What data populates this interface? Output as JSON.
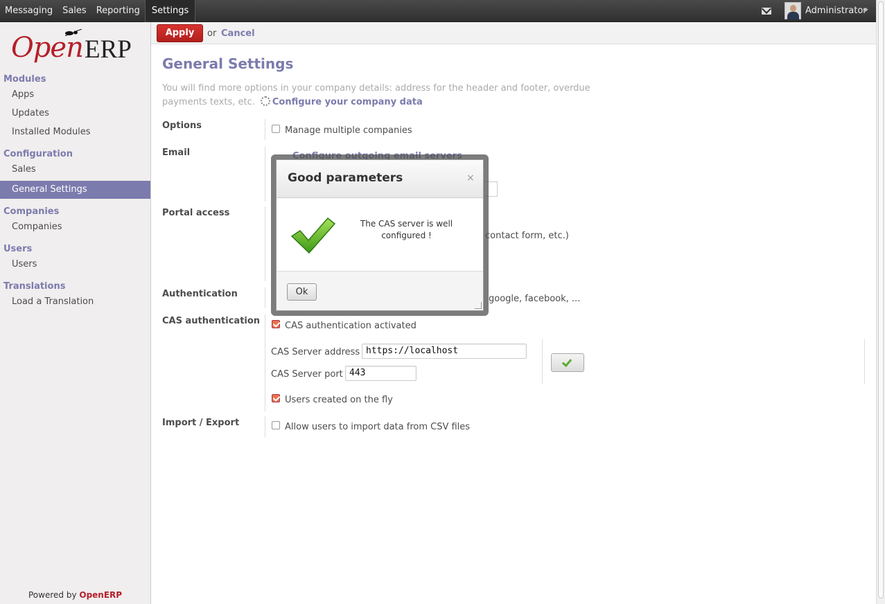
{
  "topbar": {
    "menu": [
      "Messaging",
      "Sales",
      "Reporting",
      "Settings"
    ],
    "user": "Administrator"
  },
  "logo": {
    "part1": "Open",
    "part2": "ERP"
  },
  "sidebar": {
    "modules": "Modules",
    "apps": "Apps",
    "updates": "Updates",
    "installed_modules": "Installed Modules",
    "configuration": "Configuration",
    "sales": "Sales",
    "general_settings": "General Settings",
    "companies_section": "Companies",
    "companies": "Companies",
    "users_section": "Users",
    "users": "Users",
    "translations": "Translations",
    "load_translation": "Load a Translation",
    "powered_prefix": "Powered by ",
    "powered_brand": "OpenERP"
  },
  "actions": {
    "apply": "Apply",
    "or": "or",
    "cancel": "Cancel"
  },
  "main": {
    "title": "General Settings",
    "intro": "You will find more options in your company details: address for the header and footer, overdue payments texts, etc.",
    "configure_link": "Configure your company data",
    "options_label": "Options",
    "manage_companies": "Manage multiple companies",
    "email_label": "Email",
    "email_partial": "Configure outgoing email servers",
    "portal_label": "Portal access",
    "portal_partial": "contact form, etc.)",
    "auth_label": "Authentication",
    "auth_partial": "google, facebook, ...",
    "cas_label": "CAS authentication",
    "cas_activated": "CAS authentication activated",
    "cas_address_label": "CAS Server address",
    "cas_address_value": "https://localhost",
    "cas_port_label": "CAS Server port",
    "cas_port_value": "443",
    "users_on_fly": "Users created on the fly",
    "import_label": "Import / Export",
    "import_csv": "Allow users to import data from CSV files"
  },
  "modal": {
    "title": "Good parameters",
    "close": "×",
    "message": "The CAS server is well configured !",
    "ok": "Ok"
  },
  "colors": {
    "accent": "#7c7bad",
    "brand_red": "#b41f2a",
    "apply_red": "#c92a26",
    "check_green": "#5bae2e"
  }
}
